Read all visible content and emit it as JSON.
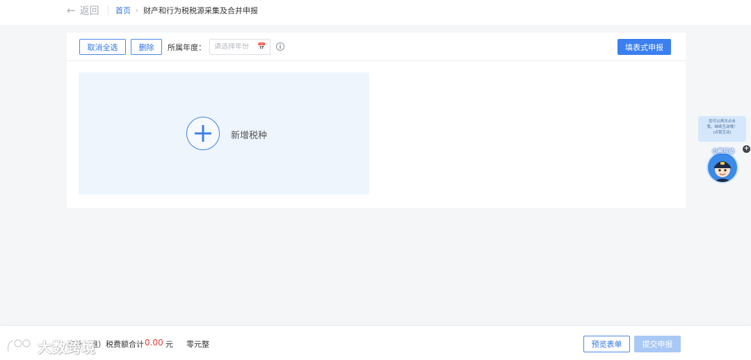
{
  "header": {
    "back_label": "返回",
    "breadcrumb_home": "首页",
    "breadcrumb_separator": "›",
    "breadcrumb_current": "财产和行为税税源采集及合并申报"
  },
  "toolbar": {
    "cancel_select_all": "取消全选",
    "delete": "删除",
    "year_label": "所属年度：",
    "year_placeholder": "请选择年份",
    "year_value": "",
    "info_glyph": "i",
    "fill_form_declare": "填表式申报"
  },
  "add_card": {
    "label": "新增税种"
  },
  "assistant": {
    "bubble_line1": "您可以再次点击",
    "bubble_line2": "我，继续互动哦！",
    "bubble_line3": "(点我互动)",
    "name": "小税互动",
    "plus_glyph": "+"
  },
  "footer": {
    "total_label": "应补（退）税费额合计",
    "total_amount": "0.00",
    "currency": "元",
    "amount_in_words": "零元整",
    "preview_button": "预览表单",
    "submit_button": "提交申报"
  },
  "watermark": {
    "text": "大数跨境"
  },
  "colors": {
    "primary": "#3b7ff0",
    "link": "#2f74e5",
    "amount": "#e03b3b",
    "card_bg": "#eef5fd",
    "page_bg": "#f5f6f8",
    "disabled_button": "#a9c8f5"
  },
  "icons": {
    "back": "arrow-left-icon",
    "calendar": "calendar-icon",
    "info": "info-icon",
    "add": "plus-circle-icon"
  }
}
